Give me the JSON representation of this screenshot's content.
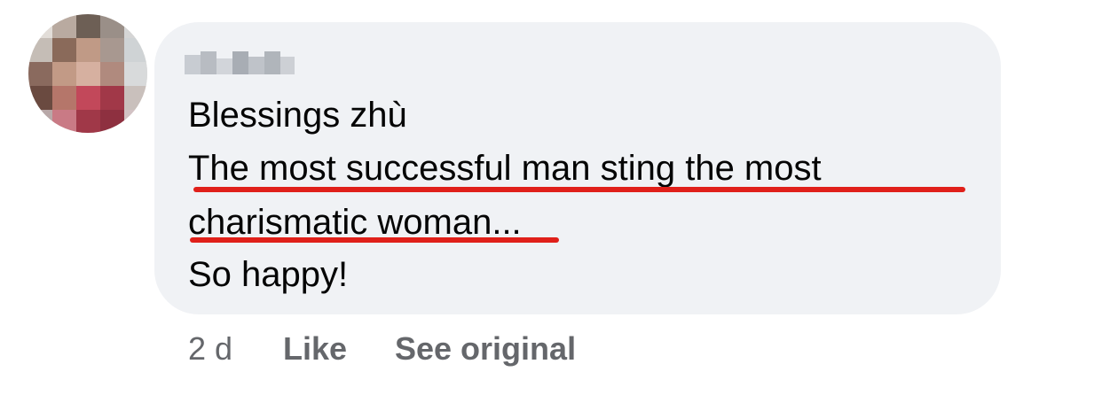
{
  "comment": {
    "lines": [
      "Blessings zhù",
      "The most successful man sting the most",
      "charismatic woman...",
      "So happy!"
    ]
  },
  "actions": {
    "timestamp": "2 d",
    "like_label": "Like",
    "see_original_label": "See original"
  },
  "colors": {
    "bubble_bg": "#f0f2f5",
    "text": "#050505",
    "meta_text": "#65676b",
    "spellcheck_underline": "#e0201a"
  }
}
